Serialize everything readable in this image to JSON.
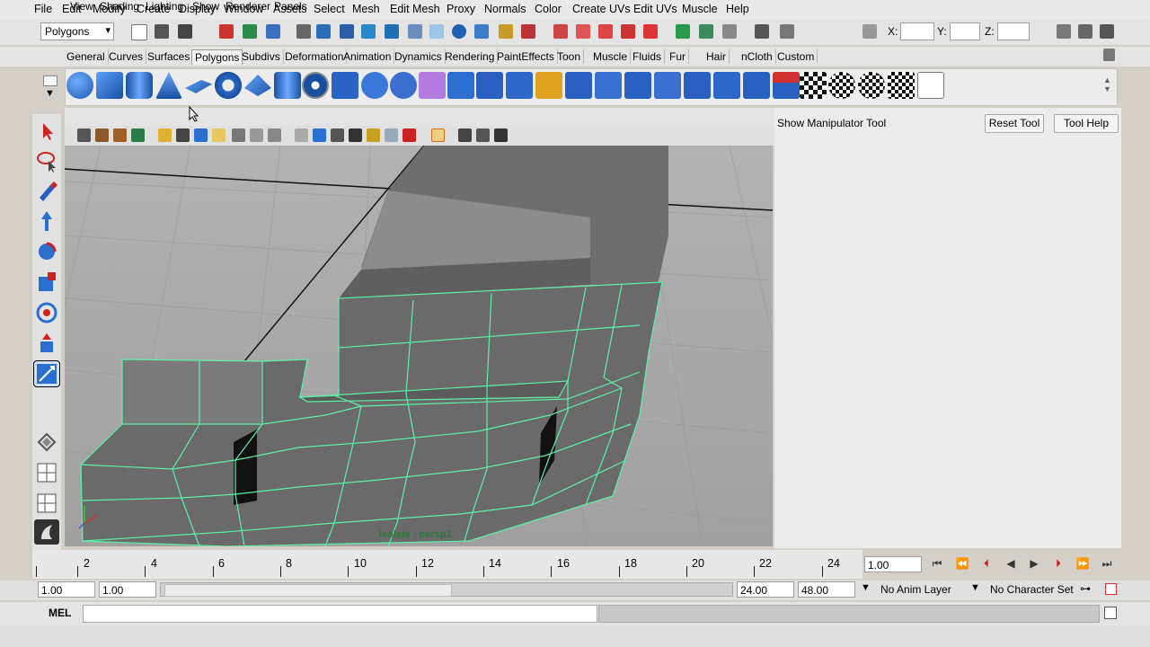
{
  "menubar": {
    "items": [
      "File",
      "Edit",
      "Modify",
      "Create",
      "Display",
      "Window",
      "Assets",
      "Select",
      "Mesh",
      "Edit Mesh",
      "Proxy",
      "Normals",
      "Color",
      "Create UVs",
      "Edit UVs",
      "Muscle",
      "Help"
    ]
  },
  "statusline": {
    "mode": "Polygons",
    "x_label": "X:",
    "y_label": "Y:",
    "z_label": "Z:"
  },
  "shelf": {
    "tabs": [
      "General",
      "Curves",
      "Surfaces",
      "Polygons",
      "Subdivs",
      "Deformation",
      "Animation",
      "Dynamics",
      "Rendering",
      "PaintEffects",
      "Toon",
      "Muscle",
      "Fluids",
      "Fur",
      "Hair",
      "nCloth",
      "Custom"
    ],
    "active_tab": "Polygons"
  },
  "panel": {
    "menus": [
      "View",
      "Shading",
      "Lighting",
      "Show",
      "Renderer",
      "Panels"
    ],
    "camera_label": "Isolate : persp1"
  },
  "tool_settings": {
    "title": "Show Manipulator Tool",
    "reset": "Reset Tool",
    "help": "Tool Help"
  },
  "timeline": {
    "ticks": [
      "2",
      "4",
      "6",
      "8",
      "10",
      "12",
      "14",
      "16",
      "18",
      "20",
      "22",
      "24"
    ],
    "current_frame": "1.00"
  },
  "range": {
    "start": "1.00",
    "start_inner": "1.00",
    "end_inner": "24.00",
    "end": "48.00",
    "anim_layer": "No Anim Layer",
    "character_set": "No Character Set"
  },
  "cmdline": {
    "label": "MEL"
  },
  "colors": {
    "wire": "#5df0a8",
    "viewport_bg": "#a7a7a7",
    "mesh": "#6c6c6c"
  }
}
